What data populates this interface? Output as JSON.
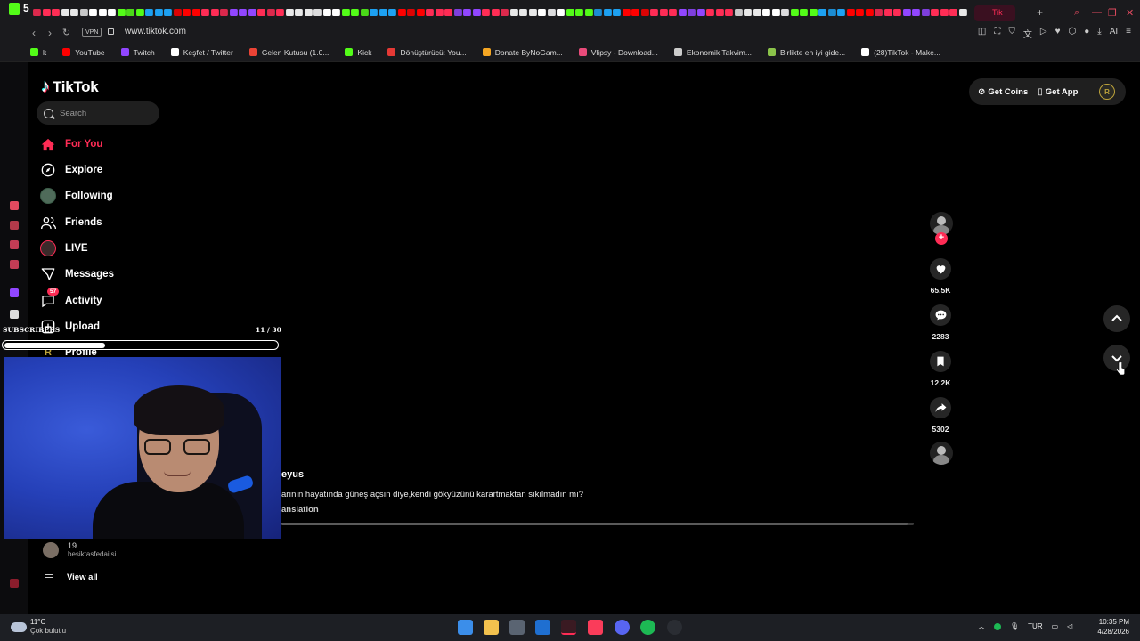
{
  "browser": {
    "tab_count": "5",
    "active_tab": "Tik",
    "url": "www.tiktok.com",
    "vpn_label": "VPN",
    "ai_label": "AI",
    "bookmarks": [
      {
        "label": "k",
        "color": "#53fc18"
      },
      {
        "label": "YouTube",
        "color": "#ff0000"
      },
      {
        "label": "Twitch",
        "color": "#9146ff"
      },
      {
        "label": "Keşfet / Twitter",
        "color": "#ffffff"
      },
      {
        "label": "Gelen Kutusu (1.0...",
        "color": "#ea4335"
      },
      {
        "label": "Kick",
        "color": "#53fc18"
      },
      {
        "label": "Dönüştürücü: You...",
        "color": "#e53935"
      },
      {
        "label": "Donate ByNoGam...",
        "color": "#f5a623"
      },
      {
        "label": "Vlipsy - Download...",
        "color": "#e94b7a"
      },
      {
        "label": "Ekonomik Takvim...",
        "color": "#cccccc"
      },
      {
        "label": "Birlikte en iyi gide...",
        "color": "#8bc34a"
      },
      {
        "label": "(28)TikTok - Make...",
        "color": "#ffffff"
      }
    ]
  },
  "tiktok": {
    "logo": "TikTok",
    "search_placeholder": "Search",
    "nav": [
      {
        "label": "For You",
        "icon": "home-icon",
        "active": true
      },
      {
        "label": "Explore",
        "icon": "compass-icon"
      },
      {
        "label": "Following",
        "icon": "following-avatar-icon"
      },
      {
        "label": "Friends",
        "icon": "friends-icon"
      },
      {
        "label": "LIVE",
        "icon": "live-icon"
      },
      {
        "label": "Messages",
        "icon": "messages-icon"
      },
      {
        "label": "Activity",
        "icon": "activity-icon",
        "badge": "57"
      },
      {
        "label": "Upload",
        "icon": "upload-icon"
      },
      {
        "label": "Profile",
        "icon": "profile-icon"
      }
    ],
    "following_account": {
      "name": "19",
      "handle": "besiktasfedailsi"
    },
    "view_all": "View all",
    "top_buttons": {
      "coins": "Get Coins",
      "app": "Get App",
      "avatar_letter": "R"
    },
    "actions": {
      "likes": "65.5K",
      "comments": "2283",
      "saves": "12.2K",
      "shares": "5302"
    },
    "video": {
      "author": "eyus",
      "caption": "arının hayatında güneş açsın diye,kendi gökyüzünü karartmaktan sıkılmadın mı?",
      "translation": "anslation",
      "progress": 0.99
    }
  },
  "stream_overlay": {
    "subs_label": "SUBSCRIBERS",
    "subs_count": "11 / 30",
    "subs_progress": 0.37
  },
  "taskbar": {
    "temperature": "11°C",
    "weather": "Çok bulutlu",
    "language": "TUR",
    "time": "10:35 PM",
    "date": "4/28/2026"
  }
}
